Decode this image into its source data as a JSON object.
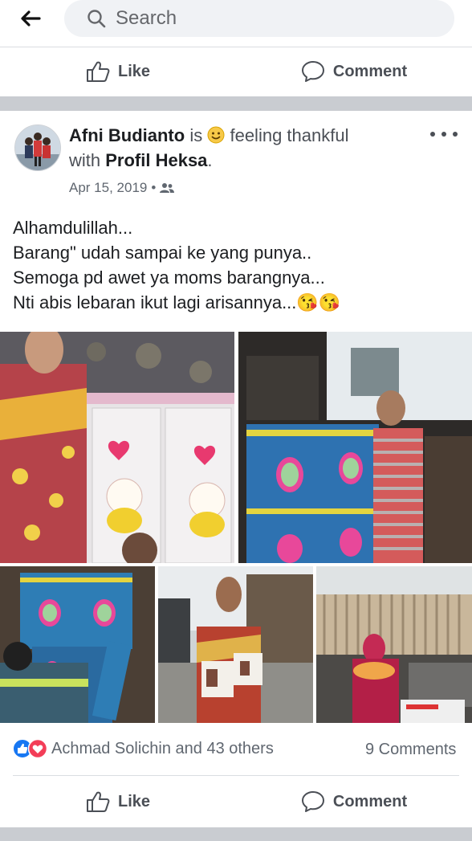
{
  "search": {
    "placeholder": "Search"
  },
  "top_actions": {
    "like": "Like",
    "comment": "Comment"
  },
  "post": {
    "author": "Afni Budianto",
    "is_word": "is",
    "feeling": "feeling thankful",
    "with_word": "with",
    "tagged": "Profil Heksa",
    "period": ".",
    "date": "Apr 15, 2019",
    "privacy_icon": "friends-icon",
    "text": "Alhamdulillah...\nBarang\" udah sampai ke yang punya..\nSemoga pd awet ya moms barangnya...\nNti abis lebaran ikut lagi arisannya...😘😘",
    "reactions_text": "Achmad Solichin and 43 others",
    "comments_count": "9 Comments"
  },
  "bottom_actions": {
    "like": "Like",
    "comment": "Comment"
  },
  "colors": {
    "facebook_blue": "#1877f2",
    "love_red": "#f33e58",
    "separator": "#c9ccd1"
  }
}
